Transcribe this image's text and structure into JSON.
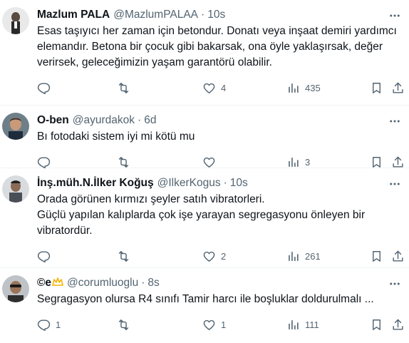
{
  "colors": {
    "text": "#0f1419",
    "muted": "#536471",
    "divider": "#eff3f4",
    "accent": "#1d9bf0"
  },
  "tweets": [
    {
      "name": "Mazlum PALA",
      "handle": "@MazlumPALAA",
      "dot": "·",
      "time": "10s",
      "text": "Esas taşıyıcı her zaman için betondur. Donatı veya inşaat demiri yardımcı elemandır. Betona bir çocuk gibi bakarsak, ona öyle yaklaşırsak, değer verirsek,  geleceğimizin yaşam garantörü olabilir.",
      "replies": "",
      "retweets": "",
      "likes": "4",
      "views": "435"
    },
    {
      "name": "O-ben",
      "handle": "@ayurdakok",
      "dot": "·",
      "time": "6d",
      "text": "Bı fotodaki sistem iyi mi kötü mu",
      "replies": "",
      "retweets": "",
      "likes": "",
      "views": "3"
    },
    {
      "name": "İnş.müh.N.İlker Koğuş",
      "handle": "@IlkerKogus",
      "dot": "·",
      "time": "10s",
      "text": "Orada görünen kırmızı şeyler satıh vibratorleri.\nGüçlü yapılan kalıplarda çok işe yarayan segregasyonu önleyen bir vibratordür.",
      "replies": "",
      "retweets": "",
      "likes": "2",
      "views": "261"
    },
    {
      "name": "©e",
      "handle": "@corumluoglu",
      "dot": "·",
      "time": "8s",
      "text": "Segragasyon olursa R4 sınıfı Tamir harcı  ile boşluklar doldurulmalı ...",
      "replies": "1",
      "retweets": "",
      "likes": "1",
      "views": "111"
    }
  ],
  "icons": {
    "more": "more-dots-icon",
    "reply": "reply-bubble-icon",
    "retweet": "retweet-icon",
    "like": "heart-icon",
    "views": "views-bar-chart-icon",
    "bookmark": "bookmark-icon",
    "share": "share-upload-icon"
  }
}
